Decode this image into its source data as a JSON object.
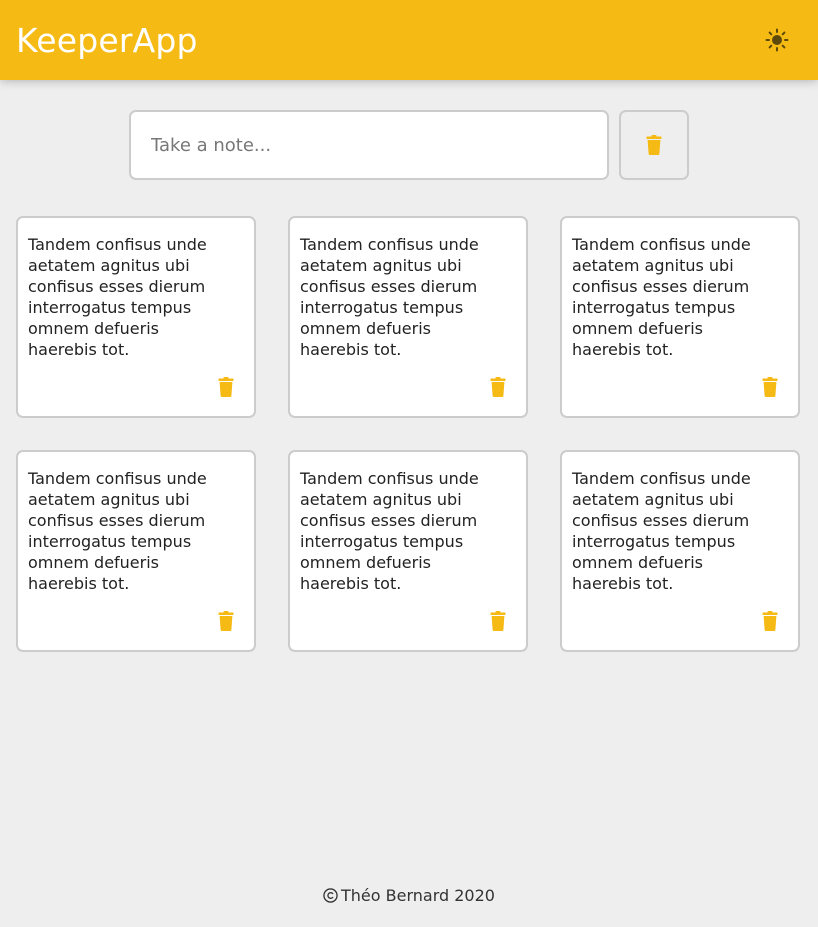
{
  "header": {
    "title": "KeeperApp",
    "theme_icon": "sun-icon"
  },
  "composer": {
    "placeholder": "Take a note...",
    "value": "",
    "clear_icon": "trash-icon"
  },
  "notes": [
    {
      "text": "Tandem confisus unde\naetatem agnitus ubi\nconfisus esses dierum\ninterrogatus tempus\nomnem defueris\nhaerebis tot.",
      "delete_icon": "trash-icon"
    },
    {
      "text": "Tandem confisus unde\naetatem agnitus ubi\nconfisus esses dierum\ninterrogatus tempus\nomnem defueris\nhaerebis tot.",
      "delete_icon": "trash-icon"
    },
    {
      "text": "Tandem confisus unde\naetatem agnitus ubi\nconfisus esses dierum\ninterrogatus tempus\nomnem defueris\nhaerebis tot.",
      "delete_icon": "trash-icon"
    },
    {
      "text": "Tandem confisus unde\naetatem agnitus ubi\nconfisus esses dierum\ninterrogatus tempus\nomnem defueris\nhaerebis tot.",
      "delete_icon": "trash-icon"
    },
    {
      "text": "Tandem confisus unde\naetatem agnitus ubi\nconfisus esses dierum\ninterrogatus tempus\nomnem defueris\nhaerebis tot.",
      "delete_icon": "trash-icon"
    },
    {
      "text": "Tandem confisus unde\naetatem agnitus ubi\nconfisus esses dierum\ninterrogatus tempus\nomnem defueris\nhaerebis tot.",
      "delete_icon": "trash-icon"
    }
  ],
  "footer": {
    "copyright_icon": "copyright-icon",
    "text": "Théo Bernard 2020"
  },
  "colors": {
    "accent": "#f5ba13",
    "background": "#eeeeee",
    "card": "#ffffff",
    "border": "#cccccc",
    "sun": "#5c4a0a"
  }
}
